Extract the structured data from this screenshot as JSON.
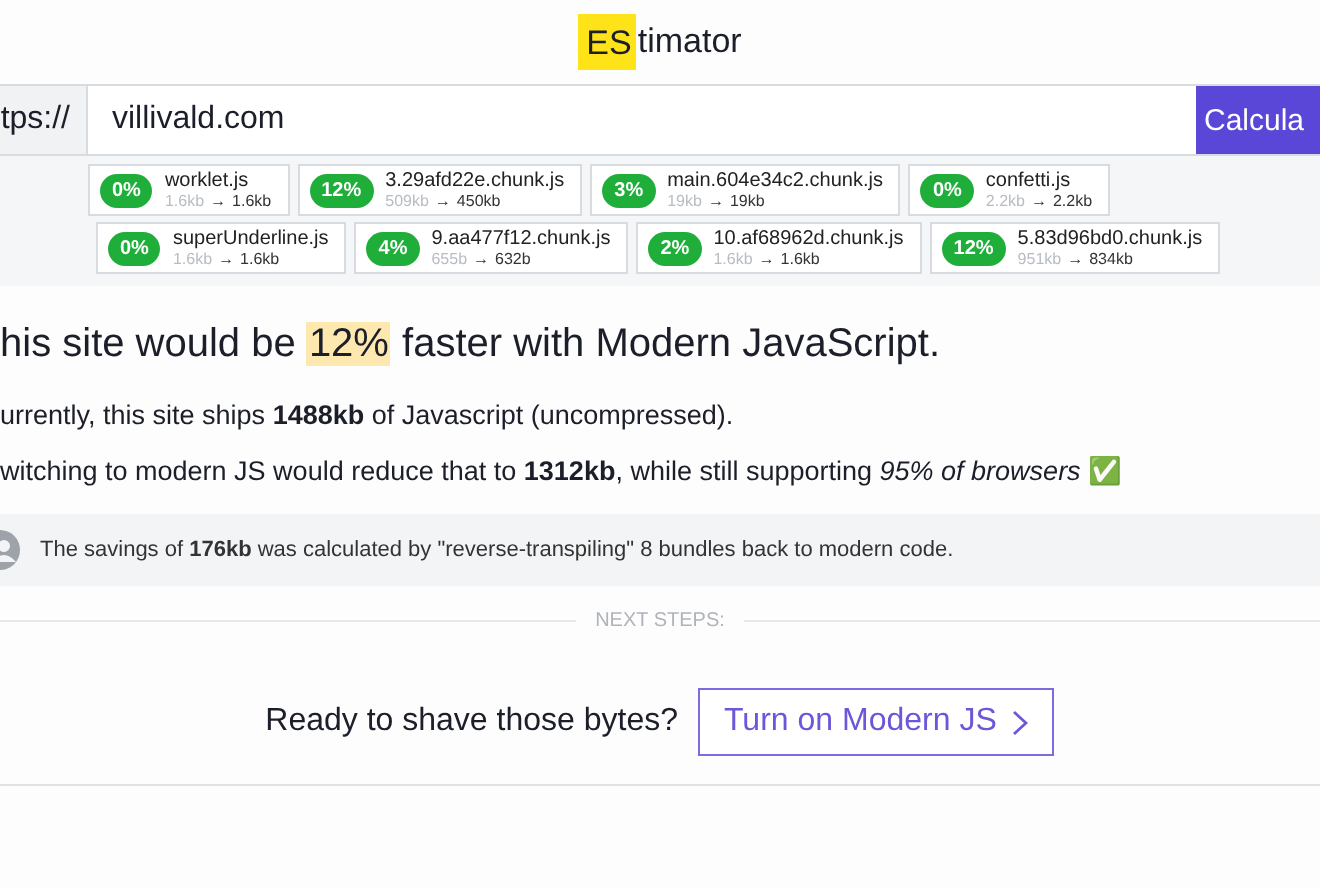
{
  "logo": {
    "mark": "ES",
    "rest": "timator"
  },
  "url_bar": {
    "prefix": "tps://",
    "value": "villivald.com",
    "button": "Calcula"
  },
  "bundle_rows": [
    [
      {
        "percent": "0%",
        "name": "worklet.js",
        "before": "1.6kb",
        "arrow": "→",
        "after": "1.6kb"
      },
      {
        "percent": "12%",
        "name": "3.29afd22e.chunk.js",
        "before": "509kb",
        "arrow": "→",
        "after": "450kb"
      },
      {
        "percent": "3%",
        "name": "main.604e34c2.chunk.js",
        "before": "19kb",
        "arrow": "→",
        "after": "19kb"
      },
      {
        "percent": "0%",
        "name": "confetti.js",
        "before": "2.2kb",
        "arrow": "→",
        "after": "2.2kb"
      }
    ],
    [
      {
        "percent": "0%",
        "name": "superUnderline.js",
        "before": "1.6kb",
        "arrow": "→",
        "after": "1.6kb"
      },
      {
        "percent": "4%",
        "name": "9.aa477f12.chunk.js",
        "before": "655b",
        "arrow": "→",
        "after": "632b"
      },
      {
        "percent": "2%",
        "name": "10.af68962d.chunk.js",
        "before": "1.6kb",
        "arrow": "→",
        "after": "1.6kb"
      },
      {
        "percent": "12%",
        "name": "5.83d96bd0.chunk.js",
        "before": "951kb",
        "arrow": "→",
        "after": "834kb"
      }
    ]
  ],
  "headline": {
    "before": "his site would be",
    "highlight": "12%",
    "after": "faster with Modern JavaScript."
  },
  "paragraphs": [
    "urrently, this site ships **1488kb** of Javascript (uncompressed).",
    "witching to modern JS would reduce that to **1312kb**, while still supporting *95% of browsers* ✅"
  ],
  "note": "The savings of **176kb** was calculated by \"reverse-transpiling\" 8 bundles back to modern code.",
  "section_label": "NEXT STEPS:",
  "cta": {
    "prompt": "Ready to shave those bytes?",
    "button": "Turn on Modern JS"
  }
}
